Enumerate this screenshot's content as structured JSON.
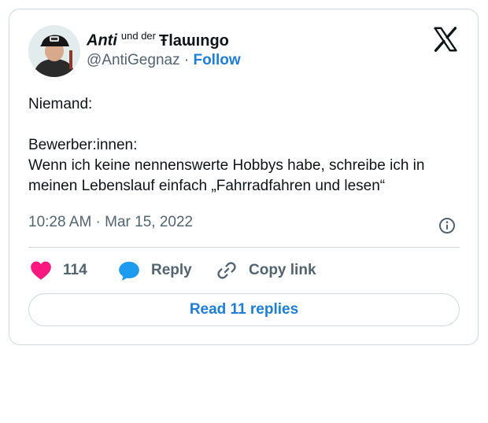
{
  "author": {
    "name_main": "Anti",
    "name_small": "und der",
    "name_deco": "Ŧlaɯıngo",
    "handle": "@AntiGegnaz",
    "separator": "·",
    "follow_label": "Follow"
  },
  "tweet": {
    "lines": [
      "Niemand:",
      "",
      "Bewerber:innen:",
      "Wenn ich keine nennenswerte Hobbys habe, schreibe ich in",
      "meinen Lebenslauf einfach „Fahrradfahren und lesen“"
    ],
    "timestamp": "10:28 AM · Mar 15, 2022"
  },
  "actions": {
    "like_count": "114",
    "reply_label": "Reply",
    "copy_label": "Copy link"
  },
  "read_replies_label": "Read 11 replies",
  "colors": {
    "like": "#f91880",
    "reply": "#1d9bf0",
    "link": "#1d7ed8",
    "muted": "#536471",
    "border": "#cfd9de"
  },
  "icons": [
    "avatar-photo",
    "x-logo-icon",
    "info-icon",
    "heart-icon",
    "reply-bubble-icon",
    "link-icon"
  ]
}
